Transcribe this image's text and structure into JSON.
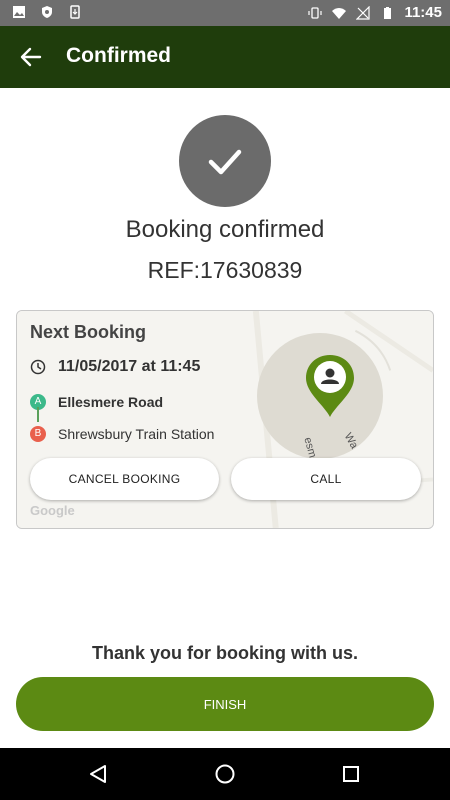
{
  "status_bar": {
    "time": "11:45",
    "icons": [
      "image-icon",
      "shield-icon",
      "download-icon",
      "vibrate-icon",
      "wifi-icon",
      "no-signal-icon",
      "battery-icon"
    ]
  },
  "toolbar": {
    "back_icon": "arrow-back-icon",
    "title": "Confirmed"
  },
  "confirmation": {
    "icon": "check-icon",
    "message": "Booking confirmed",
    "reference": "REF:17630839"
  },
  "booking_card": {
    "title": "Next Booking",
    "datetime": "11/05/2017 at 11:45",
    "pickup_badge": "A",
    "pickup": "Ellesmere Road",
    "dropoff_badge": "B",
    "dropoff": "Shrewsbury Train Station",
    "map_street_1": "esmere R",
    "map_street_2": "Wa",
    "map_attribution": "Google",
    "cancel_label": "CANCEL BOOKING",
    "call_label": "CALL"
  },
  "footer": {
    "thanks": "Thank you for booking with us.",
    "finish_label": "FINISH"
  },
  "colors": {
    "toolbar": "#1f3d0c",
    "accent": "#5c8a13",
    "pin": "#5c8a13",
    "badge_a": "#3cb98a",
    "badge_b": "#e9604d"
  }
}
